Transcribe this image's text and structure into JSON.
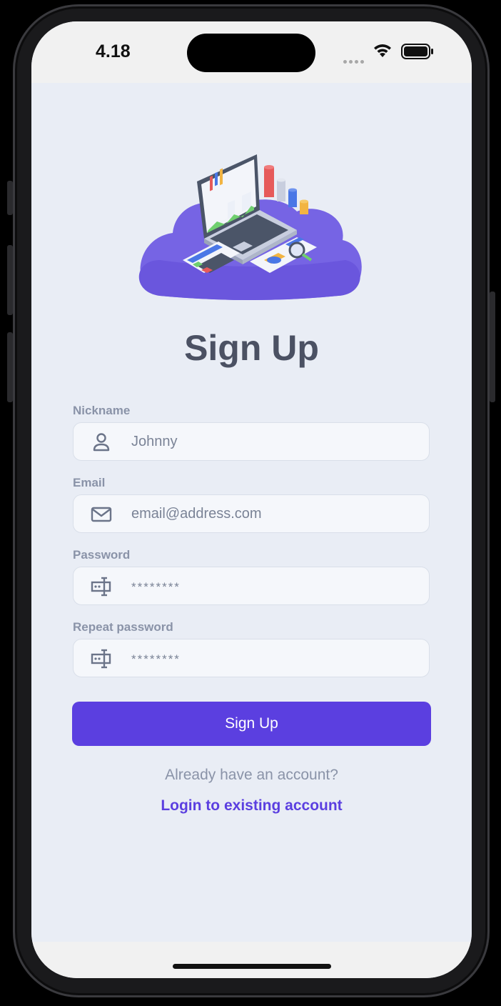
{
  "status_bar": {
    "time": "4.18",
    "icons": [
      "signal-dots-icon",
      "wifi-icon",
      "battery-icon"
    ]
  },
  "hero": {
    "icon": "laptop-analytics-illustration"
  },
  "title": "Sign Up",
  "form": {
    "nickname": {
      "label": "Nickname",
      "value": "Johnny",
      "icon": "person-icon"
    },
    "email": {
      "label": "Email",
      "value": "email@address.com",
      "icon": "envelope-icon"
    },
    "password": {
      "label": "Password",
      "value": "********",
      "icon": "password-field-icon"
    },
    "repeat_password": {
      "label": "Repeat password",
      "value": "********",
      "icon": "password-field-icon"
    }
  },
  "submit_label": "Sign Up",
  "footer": {
    "prompt": "Already have an account?",
    "link": "Login to existing account"
  },
  "colors": {
    "accent": "#5b3fe0",
    "background": "#e9edf5",
    "label": "#8a93a8",
    "title": "#4b5163"
  }
}
